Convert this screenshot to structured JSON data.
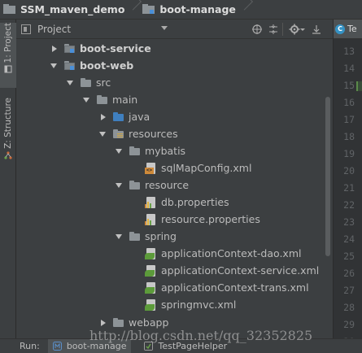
{
  "breadcrumb": {
    "project": "SSM_maven_demo",
    "module": "boot-manage"
  },
  "left_strip": {
    "project_tab": "1: Project",
    "structure_tab": "Z: Structure"
  },
  "project_panel": {
    "view_label": "Project",
    "tree": [
      {
        "label": "boot-service",
        "icon": "module-folder-icon",
        "expanded": false,
        "bold": true
      },
      {
        "label": "boot-web",
        "icon": "module-folder-icon",
        "expanded": true,
        "bold": true
      },
      {
        "label": "src",
        "icon": "folder-icon",
        "expanded": true
      },
      {
        "label": "main",
        "icon": "folder-icon",
        "expanded": true
      },
      {
        "label": "java",
        "icon": "source-folder-icon",
        "expanded": false
      },
      {
        "label": "resources",
        "icon": "resources-folder-icon",
        "expanded": true
      },
      {
        "label": "mybatis",
        "icon": "folder-icon",
        "expanded": true
      },
      {
        "label": "sqlMapConfig.xml",
        "icon": "xml-file-icon"
      },
      {
        "label": "resource",
        "icon": "folder-icon",
        "expanded": true
      },
      {
        "label": "db.properties",
        "icon": "properties-file-icon"
      },
      {
        "label": "resource.properties",
        "icon": "properties-file-icon"
      },
      {
        "label": "spring",
        "icon": "folder-icon",
        "expanded": true
      },
      {
        "label": "applicationContext-dao.xml",
        "icon": "spring-xml-icon"
      },
      {
        "label": "applicationContext-service.xml",
        "icon": "spring-xml-icon"
      },
      {
        "label": "applicationContext-trans.xml",
        "icon": "spring-xml-icon"
      },
      {
        "label": "springmvc.xml",
        "icon": "spring-xml-icon"
      },
      {
        "label": "webapp",
        "icon": "folder-icon",
        "expanded": false
      }
    ]
  },
  "editor": {
    "tab_label": "Te",
    "line_numbers": [
      "13",
      "14",
      "15",
      "16",
      "17",
      "18",
      "19",
      "20",
      "21",
      "22",
      "23",
      "24",
      "25",
      "26",
      "27",
      "28",
      "29",
      "30"
    ]
  },
  "bottom_bar": {
    "run_label": "Run:",
    "run_tabs": [
      "boot-manage",
      "TestPageHelper"
    ]
  },
  "watermark": "http://blog.csdn.net/qq_32352825",
  "colors": {
    "background": "#3c3f41",
    "editor_bg": "#2b2b2b",
    "text": "#bbbbbb",
    "accent_blue": "#3592c4"
  }
}
